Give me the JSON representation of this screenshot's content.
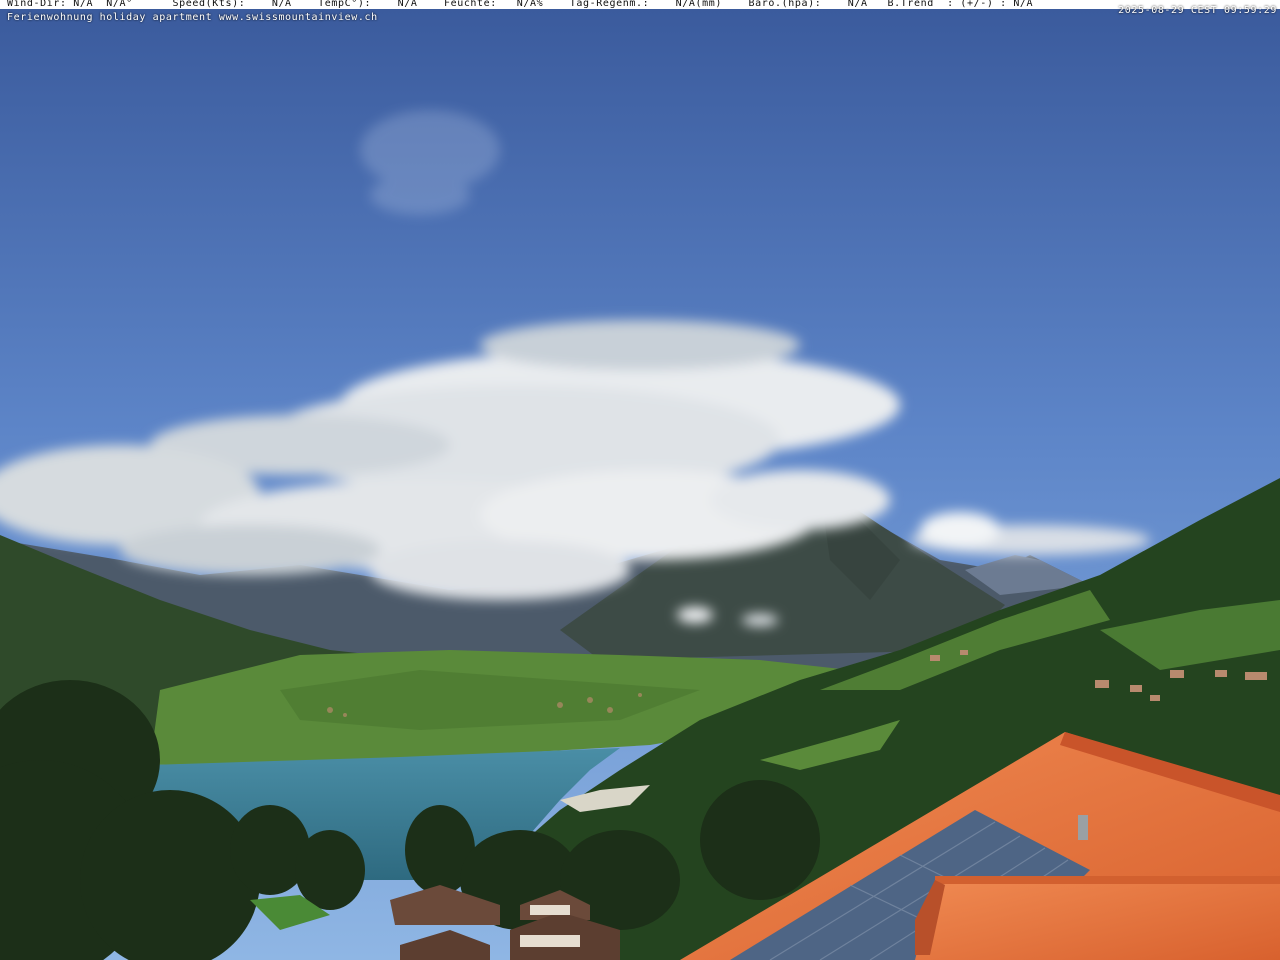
{
  "overlay": {
    "weather_line": "Wind-Dir: N/A  N/A°      Speed(Kts):    N/A    TempC°):    N/A    Feuchte:   N/A%    Tag-Regenm.:    N/A(mm)    Baro.(hpa):    N/A   B.Trend  : (+/-) : N/A",
    "timestamp": "2025-08-29 CEST 09:59:29",
    "caption": "Ferienwohnung holiday apartment www.swissmountainview.ch"
  },
  "colors": {
    "sky_top": "#3f5f9e",
    "sky_bottom": "#7ea8de",
    "lake": "#3f7f95",
    "roof": "#e8743f",
    "forest": "#23431f",
    "meadow": "#5c8a38"
  }
}
